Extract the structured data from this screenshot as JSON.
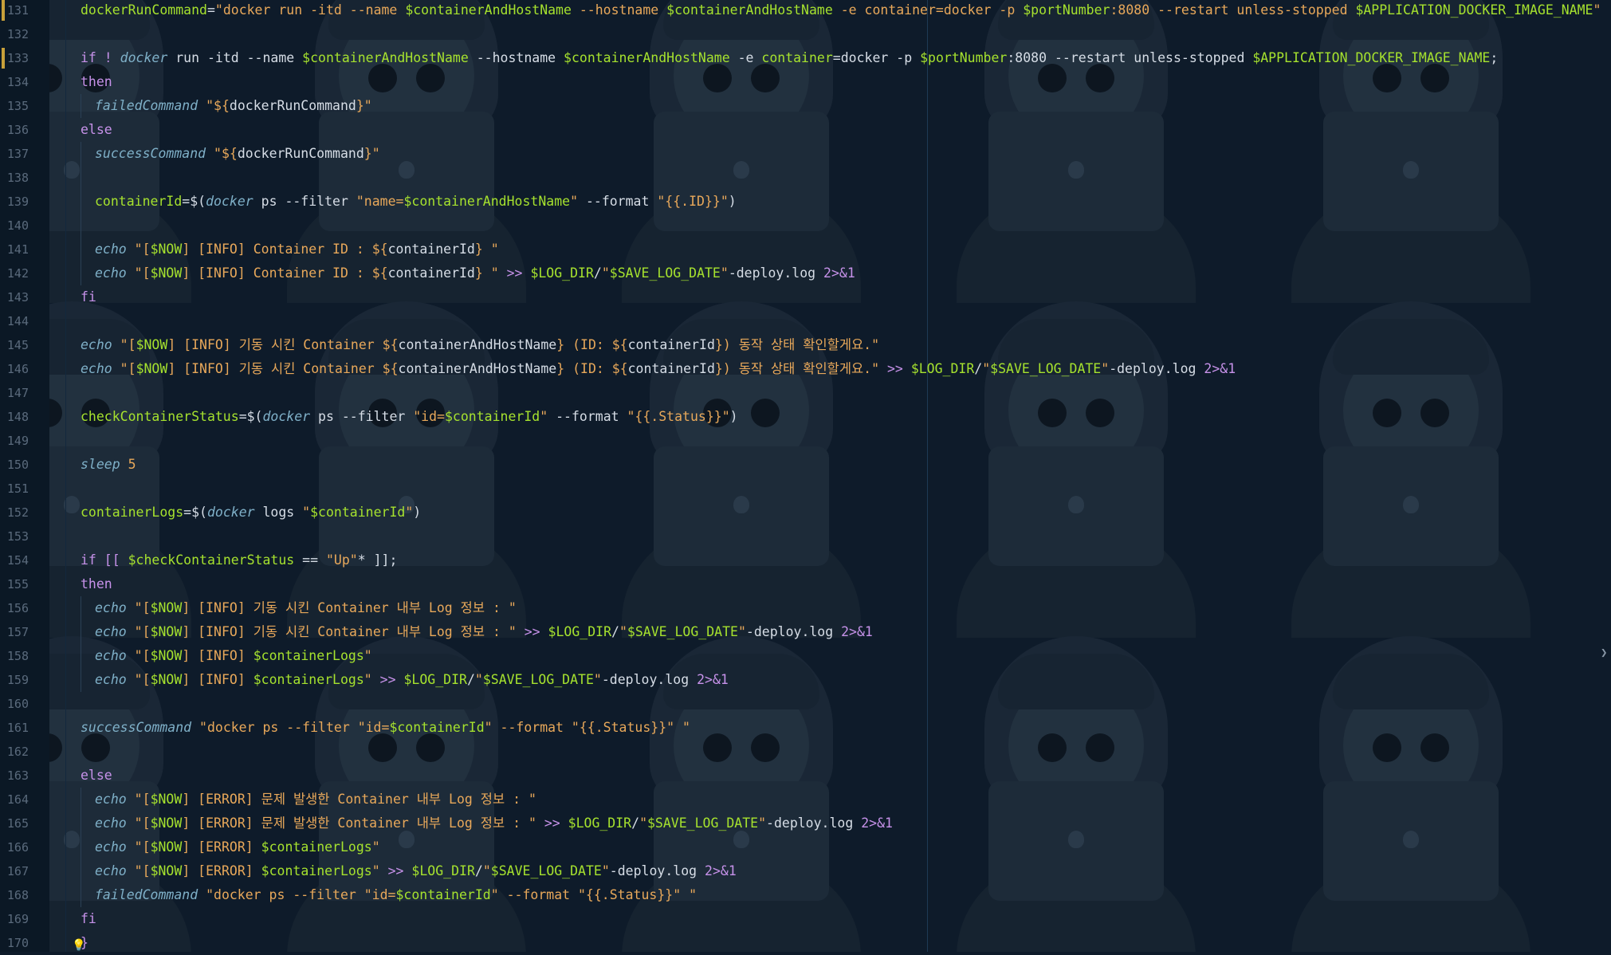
{
  "editor": {
    "colors": {
      "background": "#0e1b2a",
      "keyword": "#c792ea",
      "variable": "#a6e22e",
      "string": "#e8a85a",
      "command": "#7fb0c8",
      "plain": "#d6dde6",
      "line_number": "#5a6a7c",
      "modified_marker": "#c8a03a"
    },
    "modified_lines": [
      131,
      133
    ],
    "lines": [
      {
        "n": "131",
        "tokens": [
          [
            "var",
            "dockerRunCommand"
          ],
          [
            "plain",
            "="
          ],
          [
            "str",
            "\"docker run -itd --name "
          ],
          [
            "var",
            "$containerAndHostName"
          ],
          [
            "str",
            " --hostname "
          ],
          [
            "var",
            "$containerAndHostName"
          ],
          [
            "str",
            " -e container=docker -p "
          ],
          [
            "var",
            "$portNumber"
          ],
          [
            "str",
            ":8080 --restart unless-stopped "
          ],
          [
            "var",
            "$APPLICATION_DOCKER_IMAGE_NAME"
          ],
          [
            "str",
            "\""
          ]
        ]
      },
      {
        "n": "132",
        "tokens": []
      },
      {
        "n": "133",
        "tokens": [
          [
            "kw",
            "if ! "
          ],
          [
            "cmd",
            "docker"
          ],
          [
            "plain",
            " run -itd --name "
          ],
          [
            "var",
            "$containerAndHostName"
          ],
          [
            "plain",
            " --hostname "
          ],
          [
            "var",
            "$containerAndHostName"
          ],
          [
            "plain",
            " -e "
          ],
          [
            "var",
            "container"
          ],
          [
            "plain",
            "=docker -p "
          ],
          [
            "var",
            "$portNumber"
          ],
          [
            "plain",
            ":8080 --restart unless-stopped "
          ],
          [
            "var",
            "$APPLICATION_DOCKER_IMAGE_NAME"
          ],
          [
            "plain",
            ";"
          ]
        ]
      },
      {
        "n": "134",
        "tokens": [
          [
            "kw",
            "then"
          ]
        ]
      },
      {
        "n": "135",
        "indent": 1,
        "tokens": [
          [
            "cmd",
            "failedCommand"
          ],
          [
            "str",
            " \"${"
          ],
          [
            "plain",
            "dockerRunCommand"
          ],
          [
            "str",
            "}\""
          ]
        ]
      },
      {
        "n": "136",
        "tokens": [
          [
            "kw",
            "else"
          ]
        ]
      },
      {
        "n": "137",
        "indent": 1,
        "tokens": [
          [
            "cmd",
            "successCommand"
          ],
          [
            "str",
            " \"${"
          ],
          [
            "plain",
            "dockerRunCommand"
          ],
          [
            "str",
            "}\""
          ]
        ]
      },
      {
        "n": "138",
        "indent": 1,
        "tokens": []
      },
      {
        "n": "139",
        "indent": 1,
        "tokens": [
          [
            "var",
            "containerId"
          ],
          [
            "plain",
            "=$("
          ],
          [
            "cmd",
            "docker"
          ],
          [
            "plain",
            " ps --filter "
          ],
          [
            "str",
            "\"name="
          ],
          [
            "var",
            "$containerAndHostName"
          ],
          [
            "str",
            "\""
          ],
          [
            "plain",
            " --format "
          ],
          [
            "str",
            "\"{{.ID}}\""
          ],
          [
            "plain",
            ")"
          ]
        ]
      },
      {
        "n": "140",
        "indent": 1,
        "tokens": []
      },
      {
        "n": "141",
        "indent": 1,
        "tokens": [
          [
            "cmd",
            "echo"
          ],
          [
            "str",
            " \"["
          ],
          [
            "var",
            "$NOW"
          ],
          [
            "str",
            "] [INFO] Container ID : ${"
          ],
          [
            "plain",
            "containerId"
          ],
          [
            "str",
            "} \""
          ]
        ]
      },
      {
        "n": "142",
        "indent": 1,
        "tokens": [
          [
            "cmd",
            "echo"
          ],
          [
            "str",
            " \"["
          ],
          [
            "var",
            "$NOW"
          ],
          [
            "str",
            "] [INFO] Container ID : ${"
          ],
          [
            "plain",
            "containerId"
          ],
          [
            "str",
            "} \""
          ],
          [
            "kw",
            " >> "
          ],
          [
            "var",
            "$LOG_DIR"
          ],
          [
            "plain",
            "/"
          ],
          [
            "str",
            "\""
          ],
          [
            "var",
            "$SAVE_LOG_DATE"
          ],
          [
            "str",
            "\""
          ],
          [
            "plain",
            "-deploy.log "
          ],
          [
            "kw",
            "2>&1"
          ]
        ]
      },
      {
        "n": "143",
        "tokens": [
          [
            "kw",
            "fi"
          ]
        ]
      },
      {
        "n": "144",
        "tokens": []
      },
      {
        "n": "145",
        "tokens": [
          [
            "cmd",
            "echo"
          ],
          [
            "str",
            " \"["
          ],
          [
            "var",
            "$NOW"
          ],
          [
            "str",
            "] [INFO] 기동 시킨 Container ${"
          ],
          [
            "plain",
            "containerAndHostName"
          ],
          [
            "str",
            "} (ID: ${"
          ],
          [
            "plain",
            "containerId"
          ],
          [
            "str",
            "}) 동작 상태 확인할게요.\""
          ]
        ]
      },
      {
        "n": "146",
        "tokens": [
          [
            "cmd",
            "echo"
          ],
          [
            "str",
            " \"["
          ],
          [
            "var",
            "$NOW"
          ],
          [
            "str",
            "] [INFO] 기동 시킨 Container ${"
          ],
          [
            "plain",
            "containerAndHostName"
          ],
          [
            "str",
            "} (ID: ${"
          ],
          [
            "plain",
            "containerId"
          ],
          [
            "str",
            "}) 동작 상태 확인할게요.\""
          ],
          [
            "kw",
            " >> "
          ],
          [
            "var",
            "$LOG_DIR"
          ],
          [
            "plain",
            "/"
          ],
          [
            "str",
            "\""
          ],
          [
            "var",
            "$SAVE_LOG_DATE"
          ],
          [
            "str",
            "\""
          ],
          [
            "plain",
            "-deploy.log "
          ],
          [
            "kw",
            "2>&1"
          ]
        ]
      },
      {
        "n": "147",
        "tokens": []
      },
      {
        "n": "148",
        "tokens": [
          [
            "var",
            "checkContainerStatus"
          ],
          [
            "plain",
            "=$("
          ],
          [
            "cmd",
            "docker"
          ],
          [
            "plain",
            " ps --filter "
          ],
          [
            "str",
            "\"id="
          ],
          [
            "var",
            "$containerId"
          ],
          [
            "str",
            "\""
          ],
          [
            "plain",
            " --format "
          ],
          [
            "str",
            "\"{{.Status}}\""
          ],
          [
            "plain",
            ")"
          ]
        ]
      },
      {
        "n": "149",
        "tokens": []
      },
      {
        "n": "150",
        "tokens": [
          [
            "cmd",
            "sleep"
          ],
          [
            "str",
            " 5"
          ]
        ]
      },
      {
        "n": "151",
        "tokens": []
      },
      {
        "n": "152",
        "tokens": [
          [
            "var",
            "containerLogs"
          ],
          [
            "plain",
            "=$("
          ],
          [
            "cmd",
            "docker"
          ],
          [
            "plain",
            " logs "
          ],
          [
            "str",
            "\""
          ],
          [
            "var",
            "$containerId"
          ],
          [
            "str",
            "\""
          ],
          [
            "plain",
            ")"
          ]
        ]
      },
      {
        "n": "153",
        "tokens": []
      },
      {
        "n": "154",
        "tokens": [
          [
            "kw",
            "if [[ "
          ],
          [
            "var",
            "$checkContainerStatus"
          ],
          [
            "plain",
            " == "
          ],
          [
            "str",
            "\"Up\""
          ],
          [
            "plain",
            "* ]];"
          ]
        ]
      },
      {
        "n": "155",
        "tokens": [
          [
            "kw",
            "then"
          ]
        ]
      },
      {
        "n": "156",
        "indent": 1,
        "tokens": [
          [
            "cmd",
            "echo"
          ],
          [
            "str",
            " \"["
          ],
          [
            "var",
            "$NOW"
          ],
          [
            "str",
            "] [INFO] 기동 시킨 Container 내부 Log 정보 : \""
          ]
        ]
      },
      {
        "n": "157",
        "indent": 1,
        "tokens": [
          [
            "cmd",
            "echo"
          ],
          [
            "str",
            " \"["
          ],
          [
            "var",
            "$NOW"
          ],
          [
            "str",
            "] [INFO] 기동 시킨 Container 내부 Log 정보 : \""
          ],
          [
            "kw",
            " >> "
          ],
          [
            "var",
            "$LOG_DIR"
          ],
          [
            "plain",
            "/"
          ],
          [
            "str",
            "\""
          ],
          [
            "var",
            "$SAVE_LOG_DATE"
          ],
          [
            "str",
            "\""
          ],
          [
            "plain",
            "-deploy.log "
          ],
          [
            "kw",
            "2>&1"
          ]
        ]
      },
      {
        "n": "158",
        "indent": 1,
        "tokens": [
          [
            "cmd",
            "echo"
          ],
          [
            "str",
            " \"["
          ],
          [
            "var",
            "$NOW"
          ],
          [
            "str",
            "] [INFO] "
          ],
          [
            "var",
            "$containerLogs"
          ],
          [
            "str",
            "\""
          ]
        ]
      },
      {
        "n": "159",
        "indent": 1,
        "tokens": [
          [
            "cmd",
            "echo"
          ],
          [
            "str",
            " \"["
          ],
          [
            "var",
            "$NOW"
          ],
          [
            "str",
            "] [INFO] "
          ],
          [
            "var",
            "$containerLogs"
          ],
          [
            "str",
            "\""
          ],
          [
            "kw",
            " >> "
          ],
          [
            "var",
            "$LOG_DIR"
          ],
          [
            "plain",
            "/"
          ],
          [
            "str",
            "\""
          ],
          [
            "var",
            "$SAVE_LOG_DATE"
          ],
          [
            "str",
            "\""
          ],
          [
            "plain",
            "-deploy.log "
          ],
          [
            "kw",
            "2>&1"
          ]
        ]
      },
      {
        "n": "160",
        "tokens": []
      },
      {
        "n": "161",
        "tokens": [
          [
            "cmd",
            "successCommand"
          ],
          [
            "str",
            " \"docker ps --filter \"id="
          ],
          [
            "var",
            "$containerId"
          ],
          [
            "str",
            "\" --format \"{{.Status}}\" \""
          ]
        ]
      },
      {
        "n": "162",
        "tokens": []
      },
      {
        "n": "163",
        "tokens": [
          [
            "kw",
            "else"
          ]
        ]
      },
      {
        "n": "164",
        "indent": 1,
        "tokens": [
          [
            "cmd",
            "echo"
          ],
          [
            "str",
            " \"["
          ],
          [
            "var",
            "$NOW"
          ],
          [
            "str",
            "] [ERROR] 문제 발생한 Container 내부 Log 정보 : \""
          ]
        ]
      },
      {
        "n": "165",
        "indent": 1,
        "tokens": [
          [
            "cmd",
            "echo"
          ],
          [
            "str",
            " \"["
          ],
          [
            "var",
            "$NOW"
          ],
          [
            "str",
            "] [ERROR] 문제 발생한 Container 내부 Log 정보 : \""
          ],
          [
            "kw",
            " >> "
          ],
          [
            "var",
            "$LOG_DIR"
          ],
          [
            "plain",
            "/"
          ],
          [
            "str",
            "\""
          ],
          [
            "var",
            "$SAVE_LOG_DATE"
          ],
          [
            "str",
            "\""
          ],
          [
            "plain",
            "-deploy.log "
          ],
          [
            "kw",
            "2>&1"
          ]
        ]
      },
      {
        "n": "166",
        "indent": 1,
        "tokens": [
          [
            "cmd",
            "echo"
          ],
          [
            "str",
            " \"["
          ],
          [
            "var",
            "$NOW"
          ],
          [
            "str",
            "] [ERROR] "
          ],
          [
            "var",
            "$containerLogs"
          ],
          [
            "str",
            "\""
          ]
        ]
      },
      {
        "n": "167",
        "indent": 1,
        "tokens": [
          [
            "cmd",
            "echo"
          ],
          [
            "str",
            " \"["
          ],
          [
            "var",
            "$NOW"
          ],
          [
            "str",
            "] [ERROR] "
          ],
          [
            "var",
            "$containerLogs"
          ],
          [
            "str",
            "\""
          ],
          [
            "kw",
            " >> "
          ],
          [
            "var",
            "$LOG_DIR"
          ],
          [
            "plain",
            "/"
          ],
          [
            "str",
            "\""
          ],
          [
            "var",
            "$SAVE_LOG_DATE"
          ],
          [
            "str",
            "\""
          ],
          [
            "plain",
            "-deploy.log "
          ],
          [
            "kw",
            "2>&1"
          ]
        ]
      },
      {
        "n": "168",
        "indent": 1,
        "tokens": [
          [
            "cmd",
            "failedCommand"
          ],
          [
            "str",
            " \"docker ps --filter \"id="
          ],
          [
            "var",
            "$containerId"
          ],
          [
            "str",
            "\" --format \"{{.Status}}\" \""
          ]
        ]
      },
      {
        "n": "169",
        "tokens": [
          [
            "kw",
            "fi"
          ]
        ]
      },
      {
        "n": "170",
        "tokens": [
          [
            "kw",
            "}"
          ]
        ]
      }
    ],
    "icons": {
      "bulb": "lightbulb-icon",
      "edge": "collapse-arrow-icon"
    },
    "edge_glyph": "❯",
    "bulb_glyph": "💡"
  }
}
